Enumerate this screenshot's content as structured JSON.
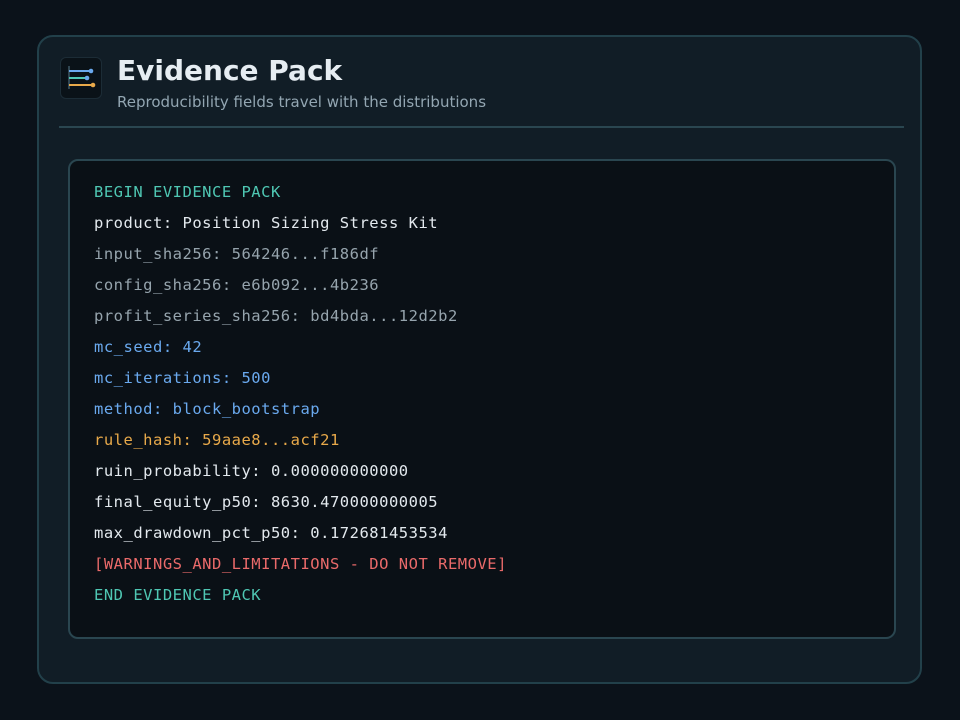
{
  "header": {
    "title": "Evidence Pack",
    "subtitle": "Reproducibility fields travel with the distributions",
    "logo_icon": "sliders-chart-icon"
  },
  "colors": {
    "background": "#0b121a",
    "card": "#111d26",
    "panel": "#0a1016",
    "teal": "#4fc7b3",
    "white": "#e3e9ee",
    "gray": "#96a4ad",
    "blue": "#6aa9ee",
    "amber": "#e8a94a",
    "red": "#ea6a6a"
  },
  "evidence_pack": {
    "lines": [
      {
        "text": "BEGIN EVIDENCE PACK",
        "tone": "teal"
      },
      {
        "text": "product: Position Sizing Stress Kit",
        "tone": "white"
      },
      {
        "text": "input_sha256: 564246...f186df",
        "tone": "gray"
      },
      {
        "text": "config_sha256: e6b092...4b236",
        "tone": "gray"
      },
      {
        "text": "profit_series_sha256: bd4bda...12d2b2",
        "tone": "gray"
      },
      {
        "text": "mc_seed: 42",
        "tone": "blue"
      },
      {
        "text": "mc_iterations: 500",
        "tone": "blue"
      },
      {
        "text": "method: block_bootstrap",
        "tone": "blue"
      },
      {
        "text": "rule_hash: 59aae8...acf21",
        "tone": "amber"
      },
      {
        "text": "ruin_probability: 0.000000000000",
        "tone": "white"
      },
      {
        "text": "final_equity_p50: 8630.470000000005",
        "tone": "white"
      },
      {
        "text": "max_drawdown_pct_p50: 0.172681453534",
        "tone": "white"
      },
      {
        "text": "[WARNINGS_AND_LIMITATIONS - DO NOT REMOVE]",
        "tone": "red"
      },
      {
        "text": "END EVIDENCE PACK",
        "tone": "teal"
      }
    ]
  }
}
